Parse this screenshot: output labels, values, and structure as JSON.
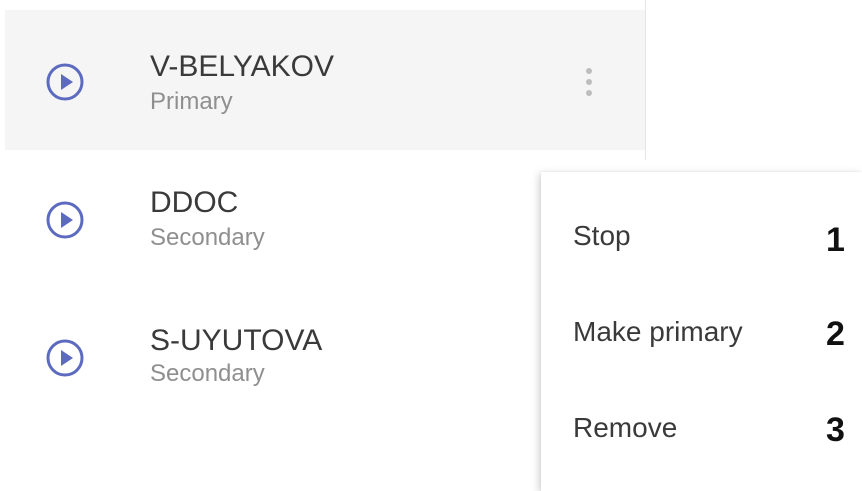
{
  "colors": {
    "accent": "#5c6bc0",
    "selected_background": "#f5f5f5",
    "title_text": "#3a3a3a",
    "subtitle_text": "#8f8f8f",
    "more_icon": "#bdbdbd"
  },
  "list": {
    "items": [
      {
        "title": "V-BELYAKOV",
        "subtitle": "Primary",
        "icon": "play-circle-icon",
        "selected": true
      },
      {
        "title": "DDOC",
        "subtitle": "Secondary",
        "icon": "play-circle-icon",
        "selected": false
      },
      {
        "title": "S-UYUTOVA",
        "subtitle": "Secondary",
        "icon": "play-circle-icon",
        "selected": false
      }
    ],
    "more_icon": "more-vertical-icon"
  },
  "context_menu": {
    "items": [
      {
        "label": "Stop",
        "number": "1"
      },
      {
        "label": "Make primary",
        "number": "2"
      },
      {
        "label": "Remove",
        "number": "3"
      }
    ]
  }
}
